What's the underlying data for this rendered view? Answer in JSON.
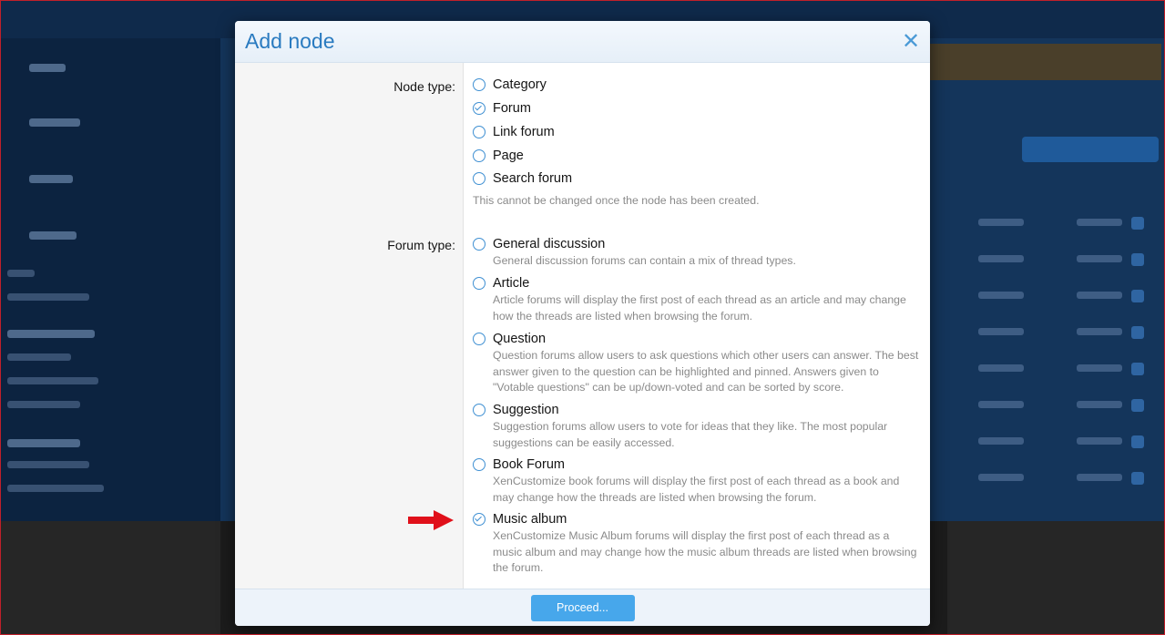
{
  "modal": {
    "title": "Add node",
    "close_symbol": "✕",
    "node_type": {
      "label": "Node type:",
      "options": [
        {
          "label": "Category",
          "checked": false
        },
        {
          "label": "Forum",
          "checked": true
        },
        {
          "label": "Link forum",
          "checked": false
        },
        {
          "label": "Page",
          "checked": false
        },
        {
          "label": "Search forum",
          "checked": false
        }
      ],
      "hint": "This cannot be changed once the node has been created."
    },
    "forum_type": {
      "label": "Forum type:",
      "options": [
        {
          "label": "General discussion",
          "checked": false,
          "desc": "General discussion forums can contain a mix of thread types."
        },
        {
          "label": "Article",
          "checked": false,
          "desc": "Article forums will display the first post of each thread as an article and may change how the threads are listed when browsing the forum."
        },
        {
          "label": "Question",
          "checked": false,
          "desc": "Question forums allow users to ask questions which other users can answer. The best answer given to the question can be highlighted and pinned. Answers given to \"Votable questions\" can be up/down-voted and can be sorted by score."
        },
        {
          "label": "Suggestion",
          "checked": false,
          "desc": "Suggestion forums allow users to vote for ideas that they like. The most popular suggestions can be easily accessed."
        },
        {
          "label": "Book Forum",
          "checked": false,
          "desc": "XenCustomize book forums will display the first post of each thread as a book and may change how the threads are listed when browsing the forum."
        },
        {
          "label": "Music album",
          "checked": true,
          "desc": "XenCustomize Music Album forums will display the first post of each thread as a music album and may change how the music album threads are listed when browsing the forum."
        }
      ]
    },
    "proceed_label": "Proceed..."
  },
  "colors": {
    "accent": "#2a7bc0",
    "button": "#47a7eb",
    "arrow": "#e0101a"
  },
  "icons": {
    "close": "close-icon",
    "annotation_arrow": "arrow-right-icon"
  }
}
